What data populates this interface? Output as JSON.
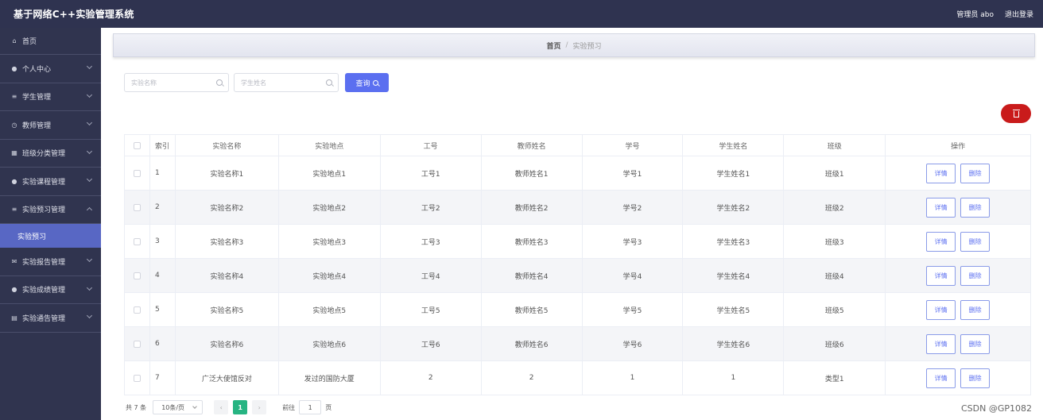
{
  "app": {
    "title": "基于网络C++实验管理系统",
    "user_label": "管理员 abo",
    "logout_label": "退出登录"
  },
  "sidebar": {
    "items": [
      {
        "label": "首页",
        "icon": "home-icon"
      },
      {
        "label": "个人中心",
        "icon": "user-icon"
      },
      {
        "label": "学生管理",
        "icon": "menu-icon"
      },
      {
        "label": "教师管理",
        "icon": "clock-icon"
      },
      {
        "label": "班级分类管理",
        "icon": "building-icon"
      },
      {
        "label": "实验课程管理",
        "icon": "user-icon"
      },
      {
        "label": "实验预习管理",
        "icon": "menu-icon"
      },
      {
        "label": "实验预习",
        "icon": ""
      },
      {
        "label": "实验报告管理",
        "icon": "mail-icon"
      },
      {
        "label": "实验成绩管理",
        "icon": "user-icon"
      },
      {
        "label": "实验通告管理",
        "icon": "document-icon"
      }
    ]
  },
  "breadcrumb": {
    "home": "首页",
    "separator": "/",
    "current": "实验预习"
  },
  "search": {
    "name_placeholder": "实验名称",
    "student_placeholder": "学生姓名",
    "query_label": "查询"
  },
  "table": {
    "headers": [
      "索引",
      "实验名称",
      "实验地点",
      "工号",
      "教师姓名",
      "学号",
      "学生姓名",
      "班级",
      "操作"
    ],
    "rows": [
      {
        "idx": "1",
        "name": "实验名称1",
        "loc": "实验地点1",
        "no": "工号1",
        "teacher": "教师姓名1",
        "sid": "学号1",
        "student": "学生姓名1",
        "cls": "班级1"
      },
      {
        "idx": "2",
        "name": "实验名称2",
        "loc": "实验地点2",
        "no": "工号2",
        "teacher": "教师姓名2",
        "sid": "学号2",
        "student": "学生姓名2",
        "cls": "班级2"
      },
      {
        "idx": "3",
        "name": "实验名称3",
        "loc": "实验地点3",
        "no": "工号3",
        "teacher": "教师姓名3",
        "sid": "学号3",
        "student": "学生姓名3",
        "cls": "班级3"
      },
      {
        "idx": "4",
        "name": "实验名称4",
        "loc": "实验地点4",
        "no": "工号4",
        "teacher": "教师姓名4",
        "sid": "学号4",
        "student": "学生姓名4",
        "cls": "班级4"
      },
      {
        "idx": "5",
        "name": "实验名称5",
        "loc": "实验地点5",
        "no": "工号5",
        "teacher": "教师姓名5",
        "sid": "学号5",
        "student": "学生姓名5",
        "cls": "班级5"
      },
      {
        "idx": "6",
        "name": "实验名称6",
        "loc": "实验地点6",
        "no": "工号6",
        "teacher": "教师姓名6",
        "sid": "学号6",
        "student": "学生姓名6",
        "cls": "班级6"
      },
      {
        "idx": "7",
        "name": "广泛大使馆反对",
        "loc": "发过的国防大厦",
        "no": "2",
        "teacher": "2",
        "sid": "1",
        "student": "1",
        "cls": "类型1"
      }
    ],
    "detail_label": "详情",
    "delete_label": "删除"
  },
  "pagination": {
    "total": "共 7 条",
    "page_size": "10条/页",
    "prev": "‹",
    "current_page": "1",
    "next": "›",
    "goto_prefix": "前往",
    "goto_value": "1",
    "goto_suffix": "页"
  },
  "watermark": "CSDN @GP1082",
  "colors": {
    "topbar": "#2f3350",
    "sidebar": "#30344f",
    "accent": "#5b6ff0",
    "danger": "#c91b1b",
    "pager_active": "#27b482"
  }
}
